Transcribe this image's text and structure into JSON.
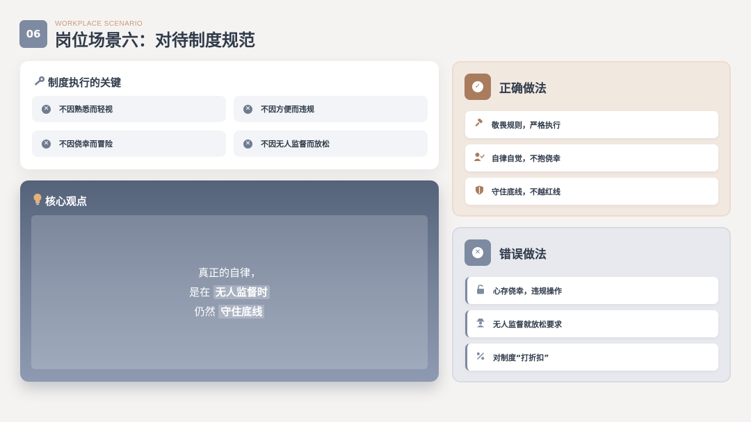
{
  "header": {
    "number": "06",
    "subtitle": "WORKPLACE SCENARIO",
    "title": "岗位场景六：对待制度规范"
  },
  "keys_card": {
    "icon": "key-icon",
    "title": "制度执行的关键",
    "items": [
      {
        "icon": "x-circle-icon",
        "label": "不因熟悉而轻视"
      },
      {
        "icon": "x-circle-icon",
        "label": "不因方便而违规"
      },
      {
        "icon": "x-circle-icon",
        "label": "不因侥幸而冒险"
      },
      {
        "icon": "x-circle-icon",
        "label": "不因无人监督而放松"
      }
    ]
  },
  "core_card": {
    "icon": "lightbulb-icon",
    "title": "核心观点",
    "line1": "真正的自律，",
    "line2_prefix": "是在",
    "line2_highlight": "无人监督时",
    "line3_prefix": "仍然",
    "line3_highlight": "守住底线"
  },
  "correct_card": {
    "icon": "check-circle-icon",
    "title": "正确做法",
    "items": [
      {
        "icon": "gavel-icon",
        "label": "敬畏规则，严格执行"
      },
      {
        "icon": "user-check-icon",
        "label": "自律自觉，不抱侥幸"
      },
      {
        "icon": "shield-icon",
        "label": "守住底线，不越红线"
      }
    ]
  },
  "wrong_card": {
    "icon": "x-circle-icon",
    "title": "错误做法",
    "items": [
      {
        "icon": "unlock-icon",
        "label": "心存侥幸，违规操作"
      },
      {
        "icon": "user-secret-icon",
        "label": "无人监督就放松要求"
      },
      {
        "icon": "percent-icon",
        "label": "对制度“打折扣”"
      }
    ]
  },
  "colors": {
    "accent_slate": "#7d8aa0",
    "accent_bronze": "#a97c5e",
    "subtitle": "#c99a7a"
  }
}
